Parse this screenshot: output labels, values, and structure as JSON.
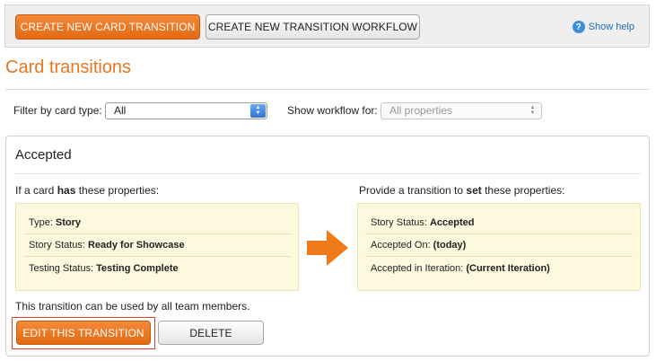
{
  "toolbar": {
    "create_card_transition": "CREATE NEW CARD TRANSITION",
    "create_transition_workflow": "CREATE NEW TRANSITION WORKFLOW",
    "help_icon": "?",
    "help_label": "Show help"
  },
  "page": {
    "title": "Card transitions"
  },
  "filters": {
    "type_label": "Filter by card type:",
    "type_value": "All",
    "workflow_label": "Show workflow for:",
    "workflow_value": "All properties"
  },
  "transition": {
    "name": "Accepted",
    "has_prefix": "If a card ",
    "has_word": "has",
    "has_suffix": " these properties:",
    "set_prefix": "Provide a transition to ",
    "set_word": "set",
    "set_suffix": " these properties:",
    "has_properties": [
      {
        "name": "Type:",
        "value": "Story"
      },
      {
        "name": "Story Status:",
        "value": "Ready for Showcase"
      },
      {
        "name": "Testing Status:",
        "value": "Testing Complete"
      }
    ],
    "set_properties": [
      {
        "name": "Story Status:",
        "value": "Accepted"
      },
      {
        "name": "Accepted On:",
        "value": "(today)"
      },
      {
        "name": "Accepted in Iteration:",
        "value": "(Current Iteration)"
      }
    ],
    "usage_note": "This transition can be used by all team members.",
    "edit_label": "EDIT THIS TRANSITION",
    "delete_label": "DELETE"
  },
  "colors": {
    "accent": "#e8761e",
    "button_orange": "#e36a12",
    "prop_box_bg": "#fdf9df",
    "help_link": "#1a6dbb",
    "highlight_border": "#d2442a"
  },
  "icons": {
    "arrow": "right-arrow-icon",
    "help": "question-mark-icon",
    "select_arrows": "up-down-arrows-icon"
  }
}
